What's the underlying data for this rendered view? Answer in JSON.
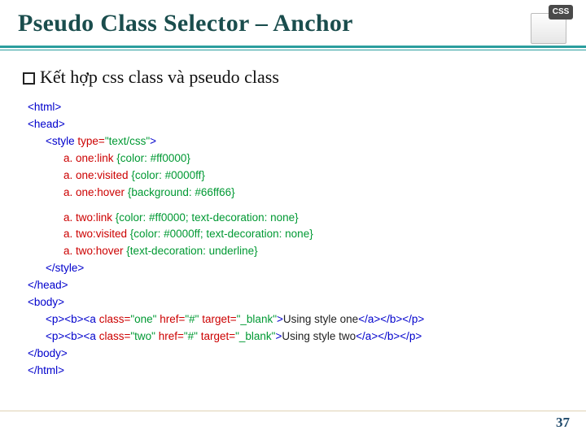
{
  "title": "Pseudo Class Selector – Anchor",
  "icon": {
    "badge": "CSS"
  },
  "bullet": "Kết hợp css class và pseudo class",
  "code": {
    "html_open": "<html>",
    "head_open": "<head>",
    "style_open_tag": "<style",
    "style_type_attr": " type=",
    "style_type_val": "\"text/css\"",
    "tag_close": ">",
    "r1_sel": "a. one:link ",
    "r1_body": "{color: #ff0000}",
    "r2_sel": "a. one:visited ",
    "r2_body": "{color: #0000ff}",
    "r3_sel": "a. one:hover ",
    "r3_body": "{background: #66ff66}",
    "r4_sel": "a. two:link ",
    "r4_body": "{color: #ff0000; text-decoration: none}",
    "r5_sel": "a. two:visited ",
    "r5_body": "{color: #0000ff; text-decoration: none}",
    "r6_sel": "a. two:hover ",
    "r6_body": "{text-decoration: underline}",
    "style_close": "</style>",
    "head_close": "</head>",
    "body_open": "<body>",
    "p_open": "<p><b><a",
    "class_attr": " class=",
    "href_attr": " href=",
    "target_attr": " target=",
    "class_one_val": "\"one\"",
    "class_two_val": "\"two\"",
    "href_val": "\"#\"",
    "target_val": "\"_blank\"",
    "link1_text": "Using style one",
    "link2_text": "Using style two",
    "p_close": "</a></b></p>",
    "body_close": "</body>",
    "html_close": "</html>"
  },
  "page_number": "37"
}
